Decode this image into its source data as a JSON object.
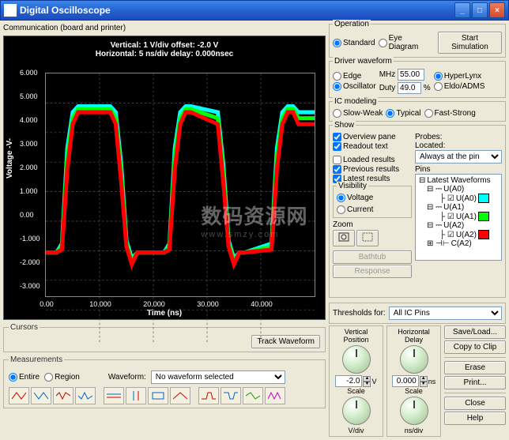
{
  "window": {
    "title": "Digital Oscilloscope",
    "min": "_",
    "max": "□",
    "close": "×"
  },
  "toolbar_hint": "Communication (board and printer)",
  "scope": {
    "header1": "Vertical: 1 V/div  offset: -2.0 V",
    "header2": "Horizontal: 5 ns/div  delay: 0.000nsec",
    "ylabel": "Voltage  -V-",
    "xlabel": "Time (ns)",
    "yticks": [
      "6.000",
      "5.000",
      "4.000",
      "3.000",
      "2.000",
      "1.000",
      "0.00",
      "-1.000",
      "-2.000",
      "-3.000"
    ],
    "xticks": [
      "0.00",
      "10.000",
      "20.000",
      "30.000",
      "40.000"
    ]
  },
  "chart_data": {
    "type": "line",
    "xlabel": "Time (ns)",
    "ylabel": "Voltage (V)",
    "xlim": [
      0,
      50
    ],
    "ylim": [
      -3,
      6
    ],
    "x": [
      0,
      2,
      3,
      4,
      5,
      6,
      12,
      13,
      14,
      15,
      16,
      17,
      22,
      23,
      24,
      25,
      26,
      27,
      32,
      33,
      34,
      35,
      36,
      37,
      42,
      43,
      44,
      45,
      46,
      47,
      50
    ],
    "series": [
      {
        "name": "U(A0)",
        "color": "#00ffff",
        "values": [
          0,
          0,
          0.3,
          3.5,
          4.7,
          4.9,
          4.9,
          4.7,
          3.0,
          0.4,
          -0.2,
          0,
          0,
          0.3,
          3.5,
          4.7,
          4.9,
          4.9,
          4.7,
          3.0,
          0.4,
          -0.2,
          0,
          0,
          0.3,
          3.5,
          4.7,
          4.9,
          4.9,
          4.7,
          4.7
        ]
      },
      {
        "name": "U(A1)",
        "color": "#00ff00",
        "values": [
          0,
          0,
          0.2,
          3.2,
          4.5,
          4.8,
          4.8,
          4.5,
          2.7,
          0.3,
          -0.3,
          0,
          0,
          0.2,
          3.2,
          4.5,
          4.8,
          4.8,
          4.5,
          2.7,
          0.3,
          -0.3,
          0,
          0,
          0.2,
          3.2,
          4.5,
          4.8,
          4.8,
          4.5,
          4.5
        ]
      },
      {
        "name": "U(A2)",
        "color": "#ff0000",
        "values": [
          0,
          0,
          0.1,
          2.8,
          4.3,
          4.7,
          4.7,
          4.3,
          2.4,
          0.2,
          -0.4,
          0,
          0,
          0.1,
          2.8,
          4.3,
          4.7,
          4.7,
          4.3,
          2.4,
          0.2,
          -0.4,
          0,
          0,
          0.1,
          2.8,
          4.3,
          4.7,
          4.7,
          4.3,
          4.3
        ]
      }
    ]
  },
  "cursors": {
    "legend": "Cursors",
    "track": "Track Waveform"
  },
  "meas": {
    "legend": "Measurements",
    "entire": "Entire",
    "region": "Region",
    "wflbl": "Waveform:",
    "wfval": "No waveform selected"
  },
  "op": {
    "legend": "Operation",
    "standard": "Standard",
    "eye": "Eye Diagram",
    "start": "Start Simulation"
  },
  "drv": {
    "legend": "Driver waveform",
    "edge": "Edge",
    "osc": "Oscillator",
    "mhz": "MHz",
    "mhz_v": "55.00",
    "duty": "Duty",
    "duty_v": "49.0",
    "hyper": "HyperLynx",
    "eldo": "Eldo/ADMS"
  },
  "ic": {
    "legend": "IC modeling",
    "slow": "Slow-Weak",
    "typical": "Typical",
    "fast": "Fast-Strong"
  },
  "show": {
    "legend": "Show",
    "overview": "Overview pane",
    "readout": "Readout text",
    "loaded": "Loaded results",
    "previous": "Previous results",
    "latest": "Latest results",
    "vis_legend": "Visibility",
    "voltage": "Voltage",
    "current": "Current",
    "zoom": "Zoom",
    "bathtub": "Bathtub",
    "response": "Response",
    "probes": "Probes:",
    "located": "Located:",
    "located_v": "Always at the pin",
    "pins": "Pins",
    "tree": {
      "root": "Latest Waveforms",
      "items": [
        {
          "label": "U(A0)",
          "sub": "U(A0)",
          "color": "#00ffff"
        },
        {
          "label": "U(A1)",
          "sub": "U(A1)",
          "color": "#00ff00"
        },
        {
          "label": "U(A2)",
          "sub": "U(A2)",
          "color": "#ff0000"
        },
        {
          "label": "C(A2)",
          "sub": "",
          "color": ""
        }
      ]
    }
  },
  "thresh": {
    "label": "Thresholds for:",
    "value": "All IC Pins"
  },
  "vpod": {
    "legend": "Vertical Position",
    "val": "-2.0",
    "unit": "V",
    "scale": "Scale",
    "scale2": "V/div"
  },
  "hpod": {
    "legend": "Horizontal Delay",
    "val": "0.000",
    "unit": "ns",
    "scale": "Scale",
    "scale2": "ns/div"
  },
  "rbtns": {
    "save": "Save/Load...",
    "copy": "Copy to Clip",
    "erase": "Erase",
    "print": "Print...",
    "close": "Close",
    "help": "Help"
  },
  "watermark": {
    "l1": "数码资源网",
    "l2": "www.smzy.com"
  }
}
